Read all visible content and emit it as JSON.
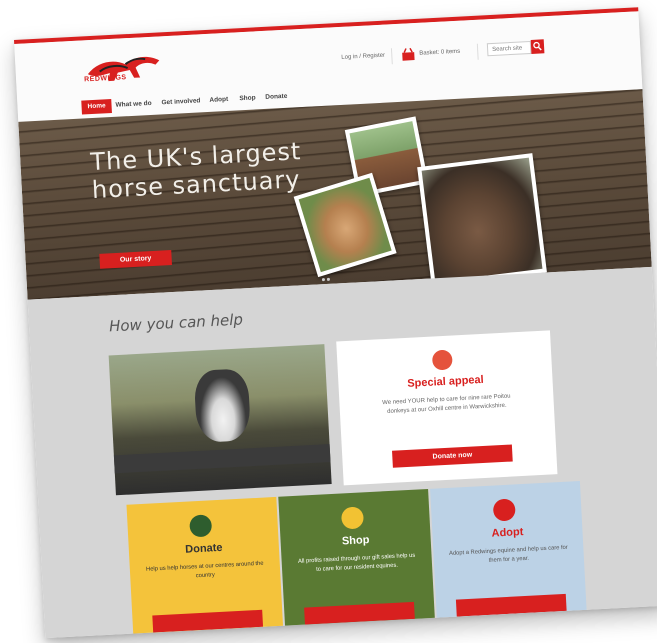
{
  "brand": {
    "logo_text": "REDWINGS",
    "accent": "#d8201f"
  },
  "header": {
    "login_text": "Log in / Register",
    "basket_text": "Basket: 0 items",
    "search_placeholder": "Search site"
  },
  "nav": {
    "items": [
      "Home",
      "What we do",
      "Get involved",
      "Adopt",
      "Shop",
      "Donate"
    ]
  },
  "hero": {
    "title_line1": "The UK's largest",
    "title_line2": "horse sanctuary",
    "button_label": "Our story"
  },
  "help": {
    "title": "How you can help",
    "appeal": {
      "title": "Special appeal",
      "body": "We need YOUR help to care for nine rare Poitou donkeys at our Oxhill centre in Warwickshire.",
      "button_label": "Donate now"
    },
    "cards": [
      {
        "title": "Donate",
        "body": "Help us help horses at our centres around the country",
        "icon": "euro-icon"
      },
      {
        "title": "Shop",
        "body": "All profits raised through our gift sales help us to care for our resident equines.",
        "icon": "basket-icon"
      },
      {
        "title": "Adopt",
        "body": "Adopt a Redwings equine and help us care for them for a year.",
        "icon": "heart-icon"
      }
    ]
  }
}
